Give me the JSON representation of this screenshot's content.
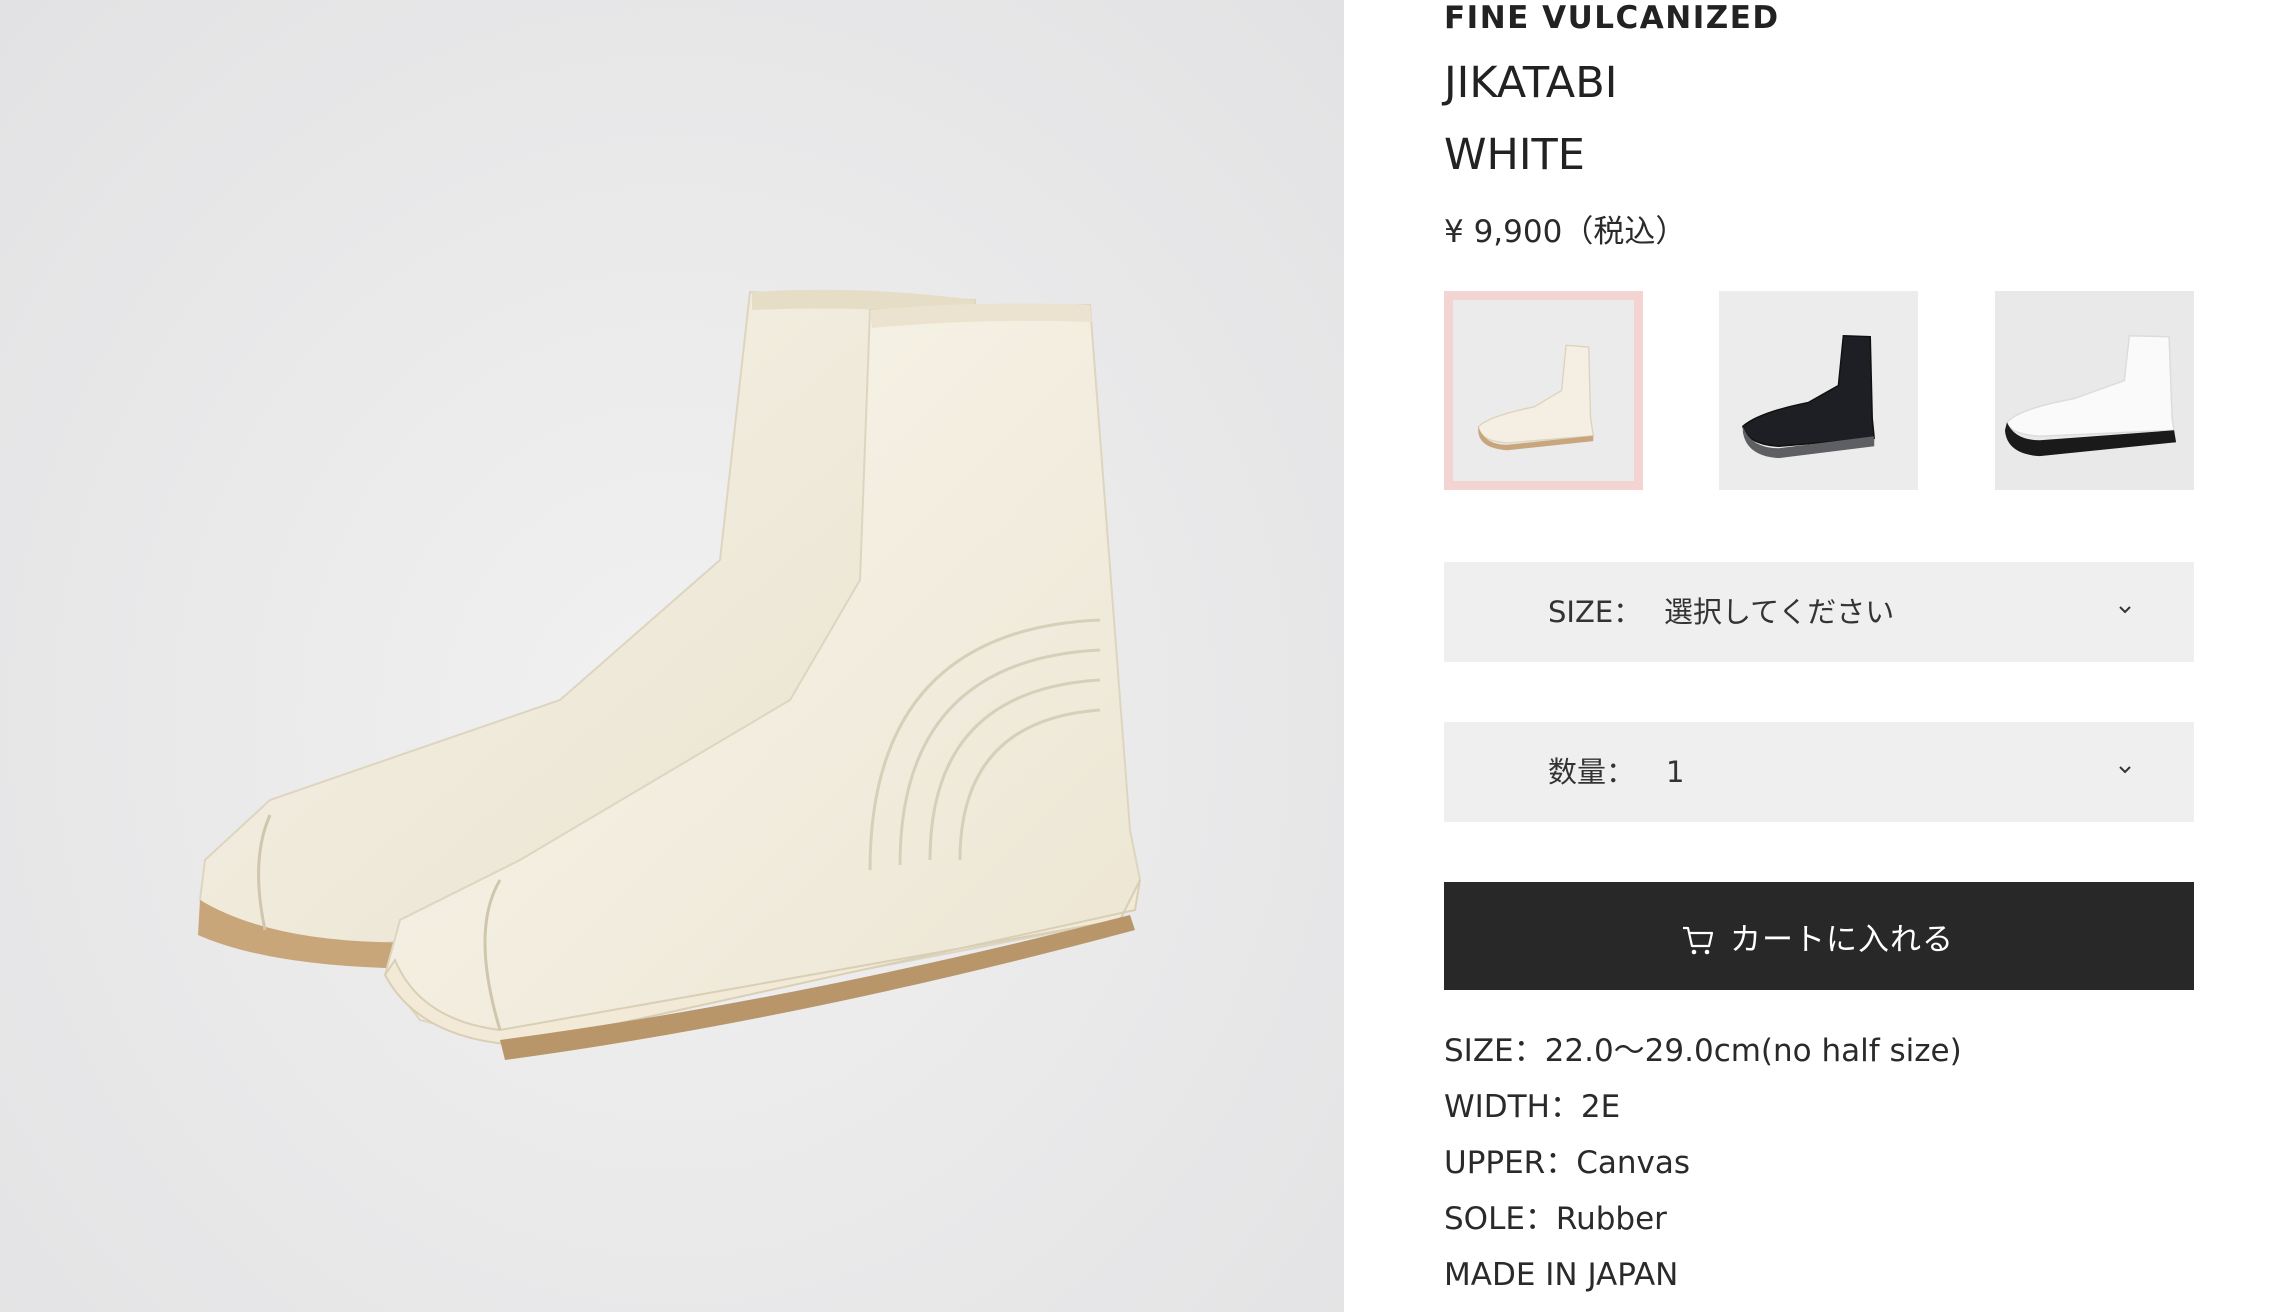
{
  "product": {
    "brand": "FINE VULCANIZED",
    "name": "JIKATABI",
    "color": "WHITE",
    "price": "¥ 9,900（税込）"
  },
  "hero_image": {
    "icon": "tabi-boots-photo"
  },
  "thumbnails": [
    {
      "variant": "white-cream",
      "selected": true
    },
    {
      "variant": "black",
      "selected": false
    },
    {
      "variant": "white-black-sole",
      "selected": false
    }
  ],
  "selectors": {
    "size": {
      "label": "SIZE：",
      "value": "選択してください",
      "icon": "chevron-down-icon"
    },
    "quantity": {
      "label": "数量：",
      "value": "1",
      "icon": "chevron-down-icon"
    }
  },
  "cart": {
    "label": "カートに入れる",
    "icon": "cart-icon"
  },
  "specs": [
    "SIZE：22.0〜29.0cm(no half size)",
    "WIDTH：2E",
    "UPPER：Canvas",
    "SOLE：Rubber",
    "MADE IN JAPAN"
  ],
  "colors": {
    "selected_border": "#f4d3d3",
    "button_bg": "#282828",
    "select_bg": "#efefef"
  }
}
